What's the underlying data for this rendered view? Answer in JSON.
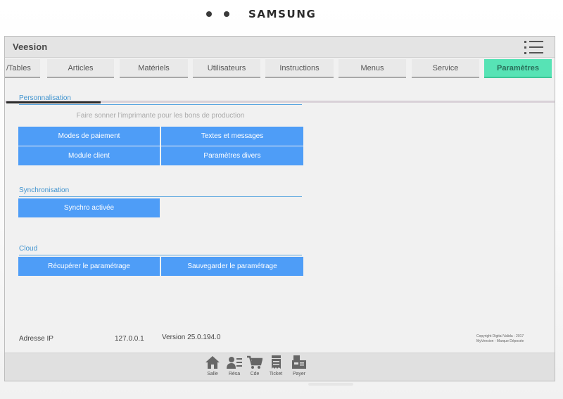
{
  "device": {
    "brand": "SAMSUNG"
  },
  "app": {
    "title": "Veesion"
  },
  "tabs": [
    {
      "label": "/Tables"
    },
    {
      "label": "Articles"
    },
    {
      "label": "Matériels"
    },
    {
      "label": "Utilisateurs"
    },
    {
      "label": "Instructions"
    },
    {
      "label": "Menus"
    },
    {
      "label": "Service"
    },
    {
      "label": "Paramètres",
      "active": true
    }
  ],
  "sections": {
    "personnalisation": {
      "title": "Personnalisation",
      "hint": "Faire sonner l'imprimante pour les bons de production",
      "buttons": [
        "Modes de paiement",
        "Textes et messages",
        "Module client",
        "Paramètres divers"
      ]
    },
    "synchronisation": {
      "title": "Synchronisation",
      "buttons": [
        "Synchro activée"
      ]
    },
    "cloud": {
      "title": "Cloud",
      "buttons": [
        "Récupérer le paramétrage",
        "Sauvegarder le paramétrage"
      ]
    }
  },
  "footer": {
    "ip_label": "Adresse IP",
    "ip_value": "127.0.0.1",
    "version": "Version 25.0.194.0",
    "copyright_line1": "Copyright Digital Valida - 2017",
    "copyright_line2": "MyVeesion - Marque Déposée"
  },
  "bottom_nav": [
    {
      "label": "Salle",
      "icon": "home-icon"
    },
    {
      "label": "Résa",
      "icon": "reservation-icon"
    },
    {
      "label": "Cde",
      "icon": "cart-icon"
    },
    {
      "label": "Ticket",
      "icon": "ticket-icon"
    },
    {
      "label": "Payer",
      "icon": "payment-terminal-icon"
    }
  ],
  "colors": {
    "accent_button": "#4e9df7",
    "active_tab": "#57e3b5",
    "section_title": "#3f93cf"
  }
}
